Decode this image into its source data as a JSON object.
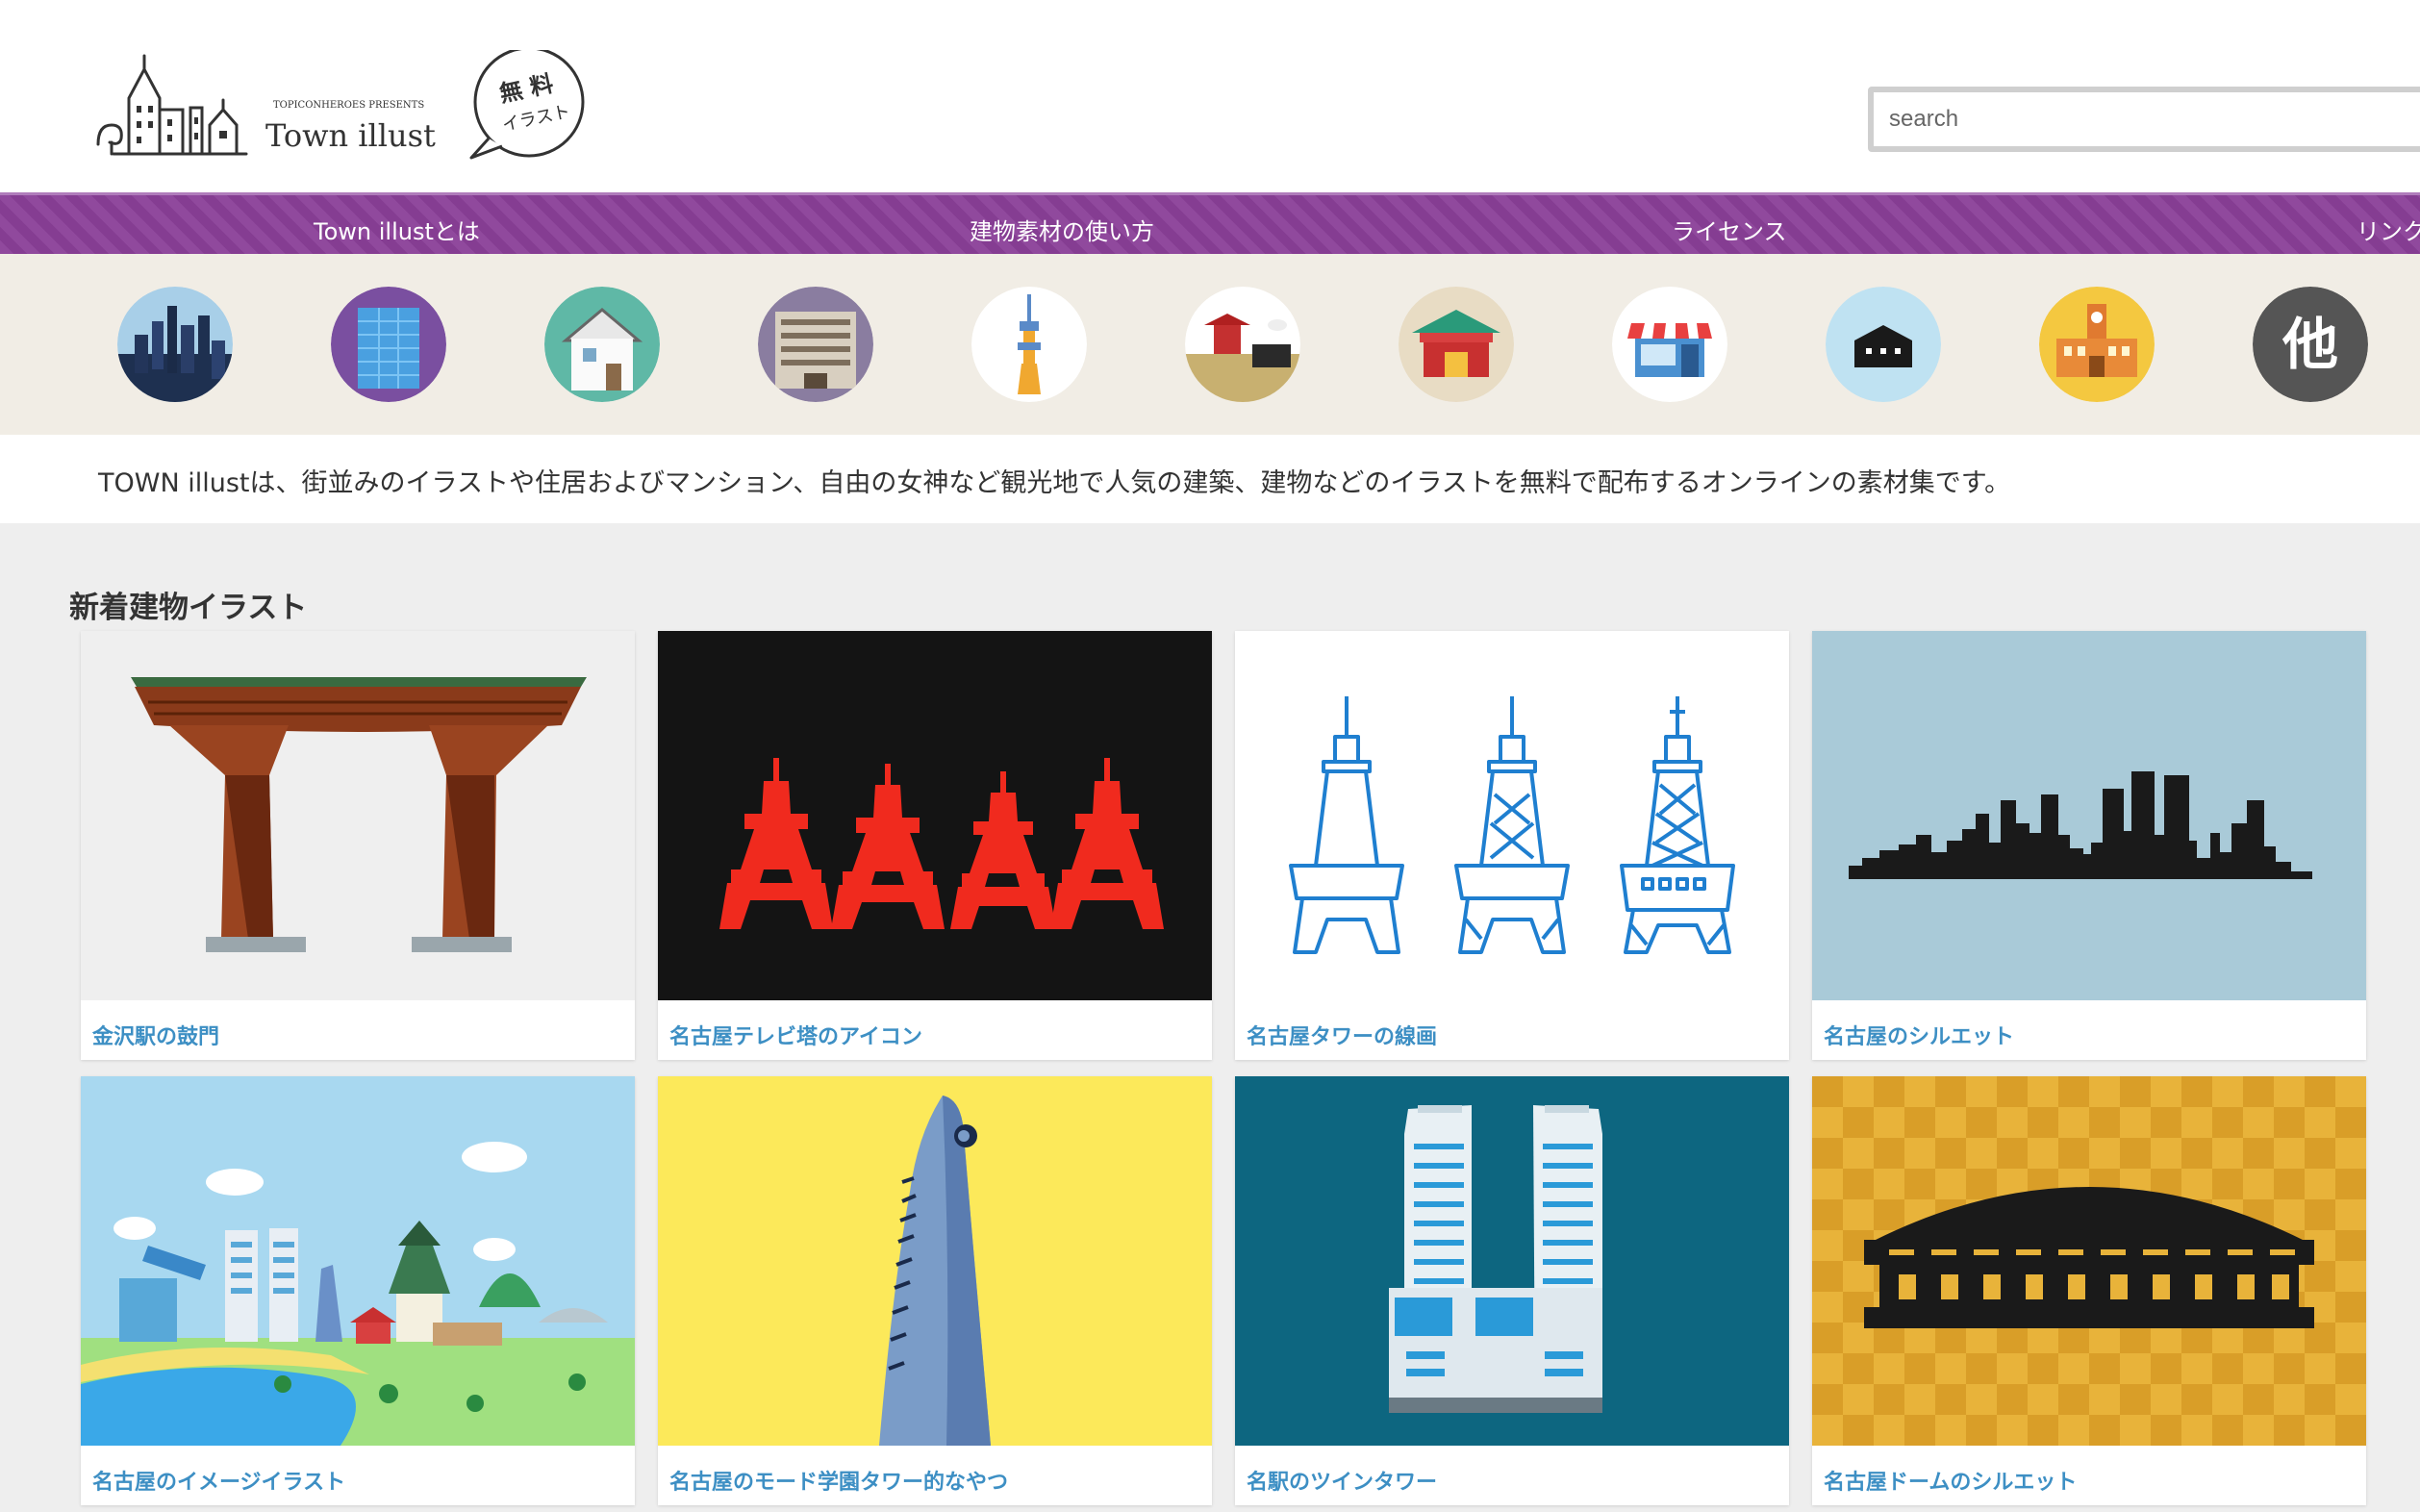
{
  "header": {
    "logo_presents": "TOPICONHEROES PRESENTS",
    "logo_name": "Town illust",
    "badge_line1": "無 料",
    "badge_line2": "イラスト",
    "search_placeholder": "search"
  },
  "nav": {
    "items": [
      {
        "label": "Town illustとは"
      },
      {
        "label": "建物素材の使い方"
      },
      {
        "label": "ライセンス"
      },
      {
        "label": "リンク"
      }
    ]
  },
  "categories": [
    {
      "icon": "city-skyline-icon",
      "color": "#1e3050"
    },
    {
      "icon": "office-building-icon",
      "color": "#7a4fa0"
    },
    {
      "icon": "house-icon",
      "color": "#5fb8a6"
    },
    {
      "icon": "apartment-icon",
      "color": "#8a7da0"
    },
    {
      "icon": "tower-icon",
      "color": "#ffffff"
    },
    {
      "icon": "temple-icon",
      "color": "#ffffff"
    },
    {
      "icon": "shrine-icon",
      "color": "#e8dcc4"
    },
    {
      "icon": "shop-icon",
      "color": "#ffffff"
    },
    {
      "icon": "silhouette-icon",
      "color": "#bfe2f2"
    },
    {
      "icon": "school-icon",
      "color": "#f4c840"
    },
    {
      "icon": "other-icon",
      "color": "#555555",
      "label": "他"
    }
  ],
  "intro": {
    "text": "TOWN illustは、街並みのイラストや住居およびマンション、自由の女神など観光地で人気の建築、建物などのイラストを無料で配布するオンラインの素材集です。"
  },
  "section": {
    "title": "新着建物イラスト"
  },
  "cards": [
    {
      "caption": "金沢駅の鼓門",
      "bg": "#efefef"
    },
    {
      "caption": "名古屋テレビ塔のアイコン",
      "bg": "#141414"
    },
    {
      "caption": "名古屋タワーの線画",
      "bg": "#ffffff"
    },
    {
      "caption": "名古屋のシルエット",
      "bg": "#a9cad8"
    },
    {
      "caption": "名古屋のイメージイラスト",
      "bg": "#a8d8f0"
    },
    {
      "caption": "名古屋のモード学園タワー的なやつ",
      "bg": "#fce95a"
    },
    {
      "caption": "名駅のツインタワー",
      "bg": "#0d6680"
    },
    {
      "caption": "名古屋ドームのシルエット",
      "bg": "#e8b33a"
    }
  ]
}
